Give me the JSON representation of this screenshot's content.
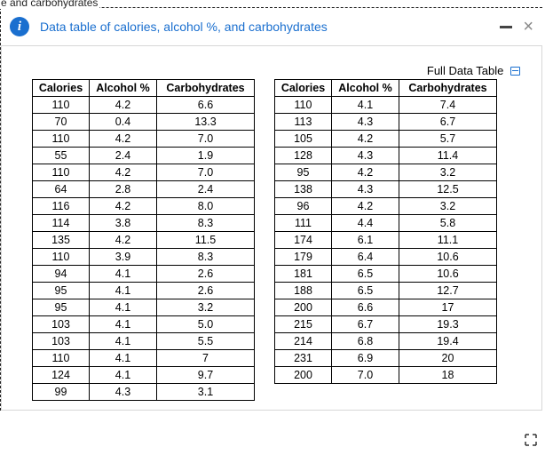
{
  "tab_label": "e and carbohydrates",
  "header": {
    "title": "Data table of calories, alcohol %, and carbohydrates"
  },
  "full_data_link": "Full Data Table",
  "columns": {
    "calories": "Calories",
    "alcohol": "Alcohol %",
    "carbs": "Carbohydrates"
  },
  "left_rows": [
    {
      "c": "110",
      "a": "4.2",
      "b": "6.6"
    },
    {
      "c": "70",
      "a": "0.4",
      "b": "13.3"
    },
    {
      "c": "110",
      "a": "4.2",
      "b": "7.0"
    },
    {
      "c": "55",
      "a": "2.4",
      "b": "1.9"
    },
    {
      "c": "110",
      "a": "4.2",
      "b": "7.0"
    },
    {
      "c": "64",
      "a": "2.8",
      "b": "2.4"
    },
    {
      "c": "116",
      "a": "4.2",
      "b": "8.0"
    },
    {
      "c": "114",
      "a": "3.8",
      "b": "8.3"
    },
    {
      "c": "135",
      "a": "4.2",
      "b": "11.5"
    },
    {
      "c": "110",
      "a": "3.9",
      "b": "8.3"
    },
    {
      "c": "94",
      "a": "4.1",
      "b": "2.6"
    },
    {
      "c": "95",
      "a": "4.1",
      "b": "2.6"
    },
    {
      "c": "95",
      "a": "4.1",
      "b": "3.2"
    },
    {
      "c": "103",
      "a": "4.1",
      "b": "5.0"
    },
    {
      "c": "103",
      "a": "4.1",
      "b": "5.5"
    },
    {
      "c": "110",
      "a": "4.1",
      "b": "7"
    },
    {
      "c": "124",
      "a": "4.1",
      "b": "9.7"
    },
    {
      "c": "99",
      "a": "4.3",
      "b": "3.1"
    }
  ],
  "right_rows": [
    {
      "c": "110",
      "a": "4.1",
      "b": "7.4"
    },
    {
      "c": "113",
      "a": "4.3",
      "b": "6.7"
    },
    {
      "c": "105",
      "a": "4.2",
      "b": "5.7"
    },
    {
      "c": "128",
      "a": "4.3",
      "b": "11.4"
    },
    {
      "c": "95",
      "a": "4.2",
      "b": "3.2"
    },
    {
      "c": "138",
      "a": "4.3",
      "b": "12.5"
    },
    {
      "c": "96",
      "a": "4.2",
      "b": "3.2"
    },
    {
      "c": "111",
      "a": "4.4",
      "b": "5.8"
    },
    {
      "c": "174",
      "a": "6.1",
      "b": "11.1"
    },
    {
      "c": "179",
      "a": "6.4",
      "b": "10.6"
    },
    {
      "c": "181",
      "a": "6.5",
      "b": "10.6"
    },
    {
      "c": "188",
      "a": "6.5",
      "b": "12.7"
    },
    {
      "c": "200",
      "a": "6.6",
      "b": "17"
    },
    {
      "c": "215",
      "a": "6.7",
      "b": "19.3"
    },
    {
      "c": "214",
      "a": "6.8",
      "b": "19.4"
    },
    {
      "c": "231",
      "a": "6.9",
      "b": "20"
    },
    {
      "c": "200",
      "a": "7.0",
      "b": "18"
    }
  ]
}
